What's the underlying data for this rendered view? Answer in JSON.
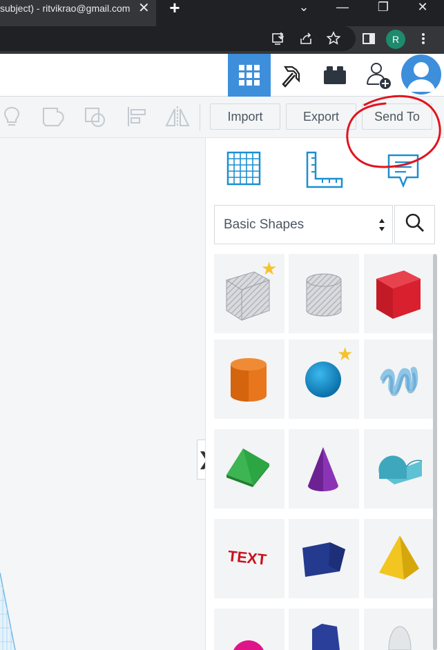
{
  "browser": {
    "tab_title": "subject) - ritvikrao@gmail.com",
    "tab_close": "✕",
    "new_tab": "+",
    "window_controls": {
      "tab_search": "⌄",
      "minimize": "—",
      "restore": "❐",
      "close": "✕"
    },
    "toolbar": {
      "profile_initial": "R",
      "icons": [
        "install-app-icon",
        "share-icon",
        "star-bookmark-icon",
        "side-panel-icon",
        "menu-dots-icon"
      ]
    }
  },
  "header": {
    "buttons": [
      "3d-design-grid-icon",
      "codeblocks-pickaxe-icon",
      "lego-brick-icon",
      "invite-user-icon"
    ],
    "active": "3d-design-grid-icon"
  },
  "workplane_toolbar": {
    "icons": [
      "note-lightbulb-icon",
      "group-icon",
      "ungroup-icon",
      "align-icon",
      "mirror-icon"
    ],
    "import_label": "Import",
    "export_label": "Export",
    "send_to_label": "Send To"
  },
  "panel": {
    "tools": [
      "workplane-icon",
      "ruler-icon",
      "notes-icon"
    ],
    "library_select": "Basic Shapes",
    "shapes": [
      {
        "name": "box-hole",
        "favorite": true
      },
      {
        "name": "cylinder-hole",
        "favorite": false
      },
      {
        "name": "box",
        "favorite": false
      },
      {
        "name": "cylinder",
        "favorite": false
      },
      {
        "name": "sphere",
        "favorite": true
      },
      {
        "name": "scribble",
        "favorite": false
      },
      {
        "name": "roof",
        "favorite": false
      },
      {
        "name": "cone",
        "favorite": false
      },
      {
        "name": "round-roof",
        "favorite": false
      },
      {
        "name": "text",
        "favorite": false
      },
      {
        "name": "polygon-prism",
        "favorite": false
      },
      {
        "name": "pyramid",
        "favorite": false
      },
      {
        "name": "half-sphere",
        "favorite": false
      },
      {
        "name": "polygon",
        "favorite": false
      },
      {
        "name": "paraboloid",
        "favorite": false
      }
    ],
    "text_shape_label": "TEXT",
    "collapse_glyph": "❯",
    "select_arrows": "▲▼"
  },
  "colors": {
    "chrome_dark": "#202124",
    "chrome_tab": "#35363a",
    "tinkercad_blue": "#3d8fdb",
    "annotation_red": "#e0141e"
  }
}
